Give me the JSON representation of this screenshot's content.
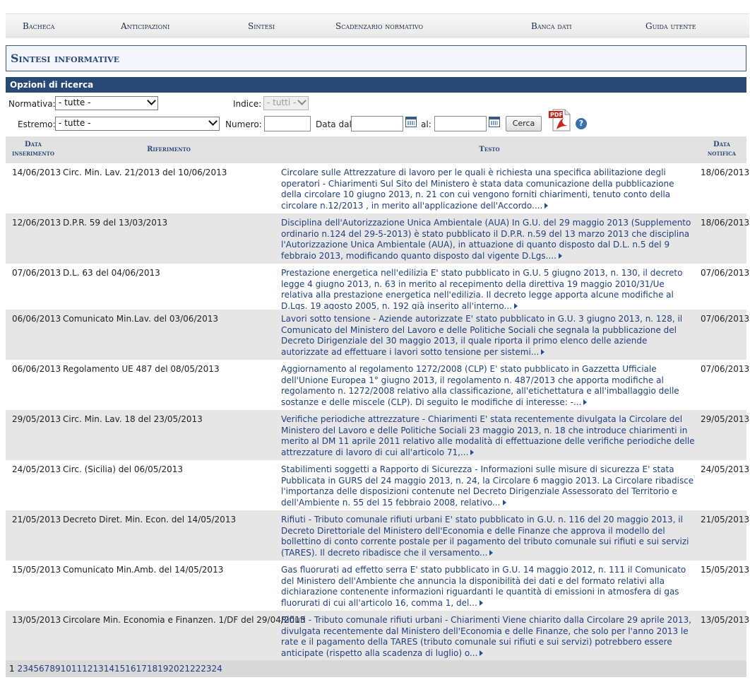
{
  "nav": [
    "Bacheca",
    "Anticipazioni",
    "Sintesi",
    "Scadenzario normativo",
    "Banca dati",
    "Guida utente"
  ],
  "page_title": "Sintesi informative",
  "search": {
    "title": "Opzioni di ricerca",
    "normativa_label": "Normativa:",
    "normativa_value": "- tutte -",
    "indice_label": "Indice:",
    "indice_value": "- tutti -",
    "estremo_label": "Estremo:",
    "estremo_value": "- tutte -",
    "numero_label": "Numero:",
    "data_dal_label": "Data dal:",
    "al_label": "al:",
    "cerca_label": "Cerca",
    "help_glyph": "?"
  },
  "icons": {
    "pdf": "pdf-export-icon",
    "calendar": "calendar-icon",
    "help": "help-icon"
  },
  "table": {
    "headers": {
      "data_ins_1": "Data",
      "data_ins_2": "inserimento",
      "riferimento": "Riferimento",
      "testo": "Testo",
      "data_not_1": "Data",
      "data_not_2": "notifica"
    },
    "rows": [
      {
        "date": "14/06/2013",
        "ref": "Circ. Min. Lav. 21/2013 del 10/06/2013",
        "text": "Circolare sulle Attrezzature di lavoro per le quali è richiesta una specifica abilitazione degli operatori - Chiarimenti Sul Sito del Ministero è stata data comunicazione della pubblicazione della circolare 10 giugno 2013, n. 21 con cui vengono forniti chiarimenti, tenuto conto della circolare n.12/2013 , in merito all'applicazione dell'Accordo....",
        "notify": "18/06/2013"
      },
      {
        "date": "12/06/2013",
        "ref": "D.P.R. 59 del 13/03/2013",
        "text": "Disciplina dell'Autorizzazione Unica Ambientale (AUA) In G.U. del 29 maggio 2013 (Supplemento ordinario n.124 del 29-5-2013) è stato pubblicato il D.P.R. n.59 del 13 marzo 2013 che disciplina l'Autorizzazione Unica Ambientale (AUA), in attuazione di quanto disposto dal D.L. n.5 del 9 febbraio 2013, modificando quanto disposto dal vigente D.Lgs....",
        "notify": "18/06/2013"
      },
      {
        "date": "07/06/2013",
        "ref": "D.L. 63 del 04/06/2013",
        "text": "Prestazione energetica nell'edilizia E' stato pubblicato in G.U. 5 giugno 2013, n. 130, il decreto legge 4 giugno 2013, n. 63 in merito al recepimento della direttiva 19 maggio 2010/31/Ue relativa alla prestazione energetica nell'edilizia. Il decreto legge apporta alcune modifiche al D.Lgs. 19 agosto 2005, n. 192 già inserito all'interno...",
        "notify": "07/06/2013"
      },
      {
        "date": "06/06/2013",
        "ref": "Comunicato Min.Lav. del 03/06/2013",
        "text": "Lavori sotto tensione - Aziende autorizzate E' stato pubblicato in G.U. 3 giugno 2013, n. 128, il Comunicato del Ministero del Lavoro e delle Politiche Sociali che segnala la pubblicazione del Decreto Dirigenziale del 30 maggio 2013, il quale riporta il primo elenco delle aziende autorizzate ad effettuare i lavori sotto tensione per sistemi...",
        "notify": "07/06/2013"
      },
      {
        "date": "06/06/2013",
        "ref": "Regolamento UE 487 del 08/05/2013",
        "text": "Aggiornamento al regolamento 1272/2008 (CLP) E' stato pubblicato in Gazzetta Ufficiale dell'Unione Europea 1° giugno 2013, il regolamento n. 487/2013 che apporta modifiche al regolamento n. 1272/2008 relativo alla classificazione, all'etichettatura e all'imballaggio delle sostanze e delle miscele (CLP). Di seguito le modifiche di interesse: -...",
        "notify": "07/06/2013"
      },
      {
        "date": "29/05/2013",
        "ref": "Circ. Min. Lav. 18 del 23/05/2013",
        "text": "Verifiche periodiche attrezzature - Chiarimenti E' stata recentemente divulgata la Circolare del Ministero del Lavoro e delle Politiche Sociali 23 maggio 2013, n. 18 che introduce chiarimenti in merito al DM 11 aprile 2011 relativo alle modalità di effettuazione delle verifiche periodiche delle attrezzature di lavoro di cui all'articolo 71,...",
        "notify": "29/05/2013"
      },
      {
        "date": "24/05/2013",
        "ref": "Circ. (Sicilia) del 06/05/2013",
        "text": "Stabilimenti soggetti a Rapporto di Sicurezza - Informazioni sulle misure di sicurezza E' stata Pubblicata in GURS del 24 maggio 2013, n. 24, la Circolare 6 maggio 2013. La Circolare ribadisce l'importanza delle disposizioni contenute nel Decreto Dirigenziale Assessorato del Territorio e dell'Ambiente n. 55 del 15 febbraio 2008, relativo...",
        "notify": "24/05/2013"
      },
      {
        "date": "21/05/2013",
        "ref": "Decreto Diret. Min. Econ. del 14/05/2013",
        "text": "Rifiuti - Tributo comunale rifiuti urbani E' stato pubblicato in G.U. n. 116 del 20 maggio 2013, il Decreto Direttoriale del Ministero dell'Economia e delle Finanze che approva il modello del bollettino di conto corrente postale per il pagamento del tributo comunale sui rifiuti e sui servizi (TARES). Il decreto ribadisce che il versamento...",
        "notify": "21/05/2013"
      },
      {
        "date": "15/05/2013",
        "ref": "Comunicato Min.Amb. del 14/05/2013",
        "text": "Gas fluorurati ad effetto serra E' stato pubblicato in G.U. 14 maggio 2012, n. 111 il Comunicato del Ministero dell'Ambiente che annuncia la disponibilità dei dati e del formato relativi alla dichiarazione contenente informazioni riguardanti le quantità di emissioni in atmosfera di gas fluorurati di cui all'articolo 16, comma 1, del...",
        "notify": "15/05/2013"
      },
      {
        "date": "13/05/2013",
        "ref": "Circolare Min. Economia e Finanzen. 1/DF del 29/04/2013",
        "text": "Rifiuti - Tributo comunale rifiuti urbani - Chiarimenti Viene chiarito dalla Circolare 29 aprile 2013, divulgata recentemente dal Ministero dell'Economia e delle Finanze, che solo per l'anno 2013 le rate e il pagamento della TARES (tributo comunale sui rifiuti e sui servizi) potrebbero essere anticipate (rispetto alla scadenza di luglio) o...",
        "notify": "13/05/2013"
      }
    ]
  },
  "pager": {
    "current": "1",
    "pages": [
      "2",
      "3",
      "4",
      "5",
      "6",
      "7",
      "8",
      "9",
      "10",
      "11",
      "12",
      "13",
      "14",
      "15",
      "16",
      "17",
      "18",
      "19",
      "20",
      "21",
      "22",
      "23",
      "24"
    ]
  }
}
